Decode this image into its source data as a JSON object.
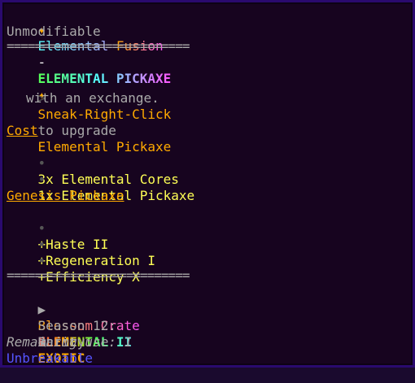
{
  "tooltip": {
    "title": {
      "star_left": "✦",
      "part1": "Elemental",
      "part2": "Fusion",
      "dash": "-",
      "item_name": "ELEMENTAL PICKAXE",
      "star_right": "✦"
    },
    "unmodifiable": "Unmodifiable",
    "separator_top": "==========================",
    "action": {
      "arrow": ">",
      "keybind": "Sneak-Right-Click",
      "text1": "to upgrade",
      "target": "Elemental Pickaxe",
      "text2": "with an exchange."
    },
    "cost": {
      "heading": "Cost",
      "items": [
        {
          "bullet": "•",
          "text": "3x Elemental Cores"
        },
        {
          "bullet": "•",
          "text": "1x Elemental Pickaxe"
        }
      ]
    },
    "genesis": {
      "heading": "Genesis Pickaxe",
      "items": [
        {
          "bullet": "•",
          "text": "+Haste II"
        },
        {
          "bullet": "•",
          "text": "+Regeneration I"
        },
        {
          "bullet": "•",
          "text": "+Efficiency X"
        }
      ]
    },
    "separator_bottom": "==========================",
    "crate": {
      "arrow_left": "▶",
      "name": "Blossom Crate",
      "arrow_right": "◀"
    },
    "season": {
      "label": "Season 12:",
      "value": "ELEMENTAL II"
    },
    "rarity": {
      "label": "Rarity:",
      "value": "EXOTIC"
    },
    "remaining": "Remaining use: 1",
    "unbreakable": "Unbreakable"
  },
  "colors": {
    "background": "#17041f",
    "border": "#2a0a6e",
    "gold": "#ffaa00",
    "yellow": "#ffff55",
    "gray": "#aaaaaa",
    "blue": "#5555ff"
  }
}
